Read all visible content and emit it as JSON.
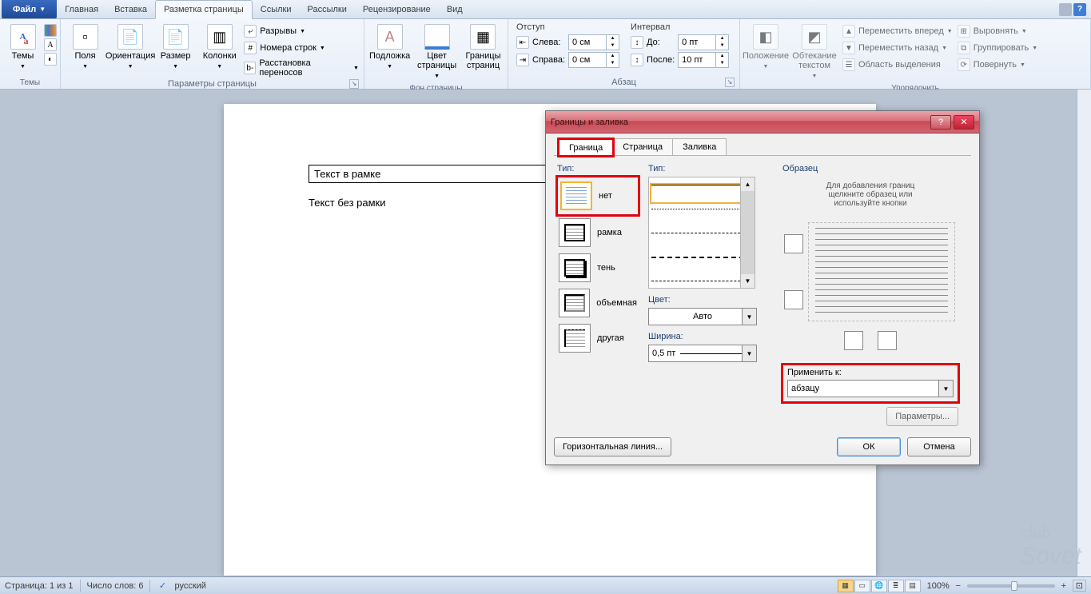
{
  "menu": {
    "file": "Файл",
    "tabs": [
      "Главная",
      "Вставка",
      "Разметка страницы",
      "Ссылки",
      "Рассылки",
      "Рецензирование",
      "Вид"
    ],
    "active": 2
  },
  "ribbon": {
    "themes": {
      "btn": "Темы",
      "label": "Темы"
    },
    "page_params": {
      "poля": "Поля",
      "orient": "Ориентация",
      "size": "Размер",
      "cols": "Колонки",
      "breaks": "Разрывы",
      "line_nums": "Номера строк",
      "hyphen": "Расстановка переносов",
      "label": "Параметры страницы"
    },
    "page_bg": {
      "watermark": "Подложка",
      "page_color": "Цвет\nстраницы",
      "borders": "Границы\nстраниц",
      "label": "Фон страницы"
    },
    "paragraph": {
      "indent_label": "Отступ",
      "interval_label": "Интервал",
      "left": "Слева:",
      "right": "Справа:",
      "before": "До:",
      "after": "После:",
      "left_v": "0 см",
      "right_v": "0 см",
      "before_v": "0 пт",
      "after_v": "10 пт",
      "label": "Абзац"
    },
    "arrange": {
      "pos": "Положение",
      "wrap": "Обтекание\nтекстом",
      "fwd": "Переместить вперед",
      "back": "Переместить назад",
      "sel": "Область выделения",
      "align": "Выровнять",
      "group": "Группировать",
      "rotate": "Повернуть",
      "label": "Упорядочить"
    }
  },
  "doc": {
    "framed": "Текст в рамке",
    "unframed": "Текст без рамки"
  },
  "dialog": {
    "title": "Границы и заливка",
    "tabs": [
      "Граница",
      "Страница",
      "Заливка"
    ],
    "active": 0,
    "type_label": "Тип:",
    "type2_label": "Тип:",
    "settings": [
      "нет",
      "рамка",
      "тень",
      "объемная",
      "другая"
    ],
    "color_label": "Цвет:",
    "color_val": "Авто",
    "width_label": "Ширина:",
    "width_val": "0,5 пт",
    "preview_label": "Образец",
    "preview_hint": "Для добавления границ\nщелкните образец или\nиспользуйте кнопки",
    "apply_label": "Применить к:",
    "apply_val": "абзацу",
    "params_btn": "Параметры...",
    "hline": "Горизонтальная линия...",
    "ok": "ОК",
    "cancel": "Отмена"
  },
  "status": {
    "page": "Страница: 1 из 1",
    "words": "Число слов: 6",
    "lang": "русский",
    "zoom": "100%"
  }
}
